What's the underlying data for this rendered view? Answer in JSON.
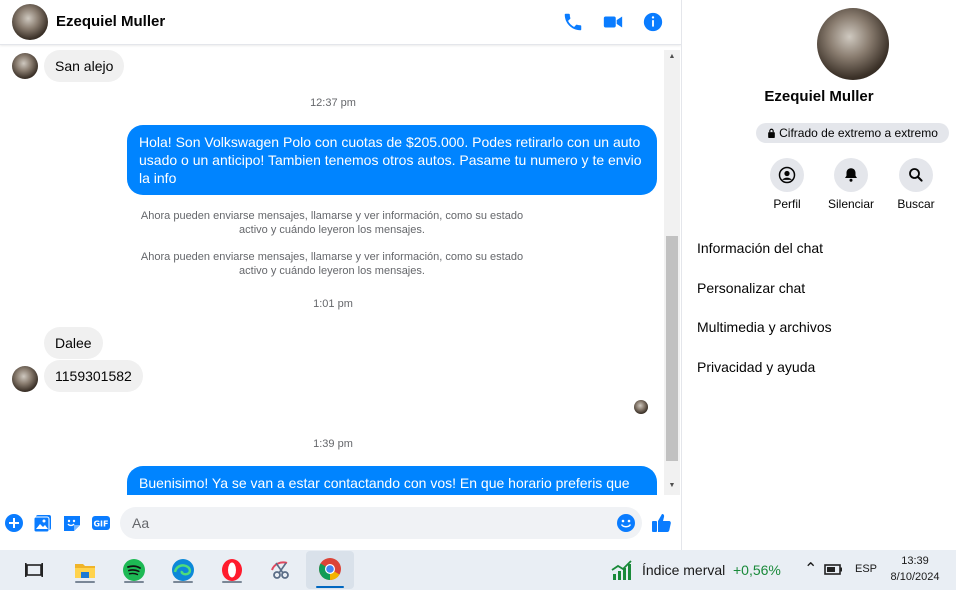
{
  "header": {
    "contact_name": "Ezequiel Muller",
    "icons": [
      "phone-icon",
      "video-camera-icon",
      "info-icon"
    ]
  },
  "messages": {
    "m1": "San alejo",
    "t1": "12:37 pm",
    "m2": "Hola! Son Volkswagen Polo con cuotas de $205.000. Podes retirarlo con un auto usado o un anticipo! Tambien tenemos otros autos. Pasame tu numero y te envio la info",
    "notice1": "Ahora pueden enviarse mensajes, llamarse y ver información, como su estado activo y cuándo leyeron los mensajes.",
    "notice2": "Ahora pueden enviarse mensajes, llamarse y ver información, como su estado activo y cuándo leyeron los mensajes.",
    "t2": "1:01 pm",
    "m3": "Dalee",
    "m4": "1159301582",
    "t3": "1:39 pm",
    "m5": "Buenisimo! Ya se van a estar contactando con vos! En que horario preferis que se"
  },
  "composer": {
    "placeholder": "Aa",
    "icons": [
      "plus-icon",
      "image-icon",
      "sticker-icon",
      "gif-icon",
      "emoji-icon",
      "thumbs-up-icon"
    ]
  },
  "sidebar": {
    "name": "Ezequiel Muller",
    "encryption_label": "Cifrado de extremo a extremo",
    "actions": [
      {
        "label": "Perfil",
        "icon": "profile-icon"
      },
      {
        "label": "Silenciar",
        "icon": "bell-icon"
      },
      {
        "label": "Buscar",
        "icon": "search-icon"
      }
    ],
    "menu": [
      "Información del chat",
      "Personalizar chat",
      "Multimedia y archivos",
      "Privacidad y ayuda"
    ]
  },
  "taskbar": {
    "apps": [
      "task-view-icon",
      "file-explorer-icon",
      "spotify-icon",
      "edge-icon",
      "opera-icon",
      "snipping-tool-icon",
      "chrome-icon"
    ],
    "stock_name": "Índice merval",
    "stock_change": "+0,56%",
    "language": "ESP",
    "time": "13:39",
    "date": "8/10/2024"
  },
  "colors": {
    "messenger_blue": "#0084ff",
    "icon_blue": "#0a7cff",
    "stock_green": "#1a8a3a"
  }
}
